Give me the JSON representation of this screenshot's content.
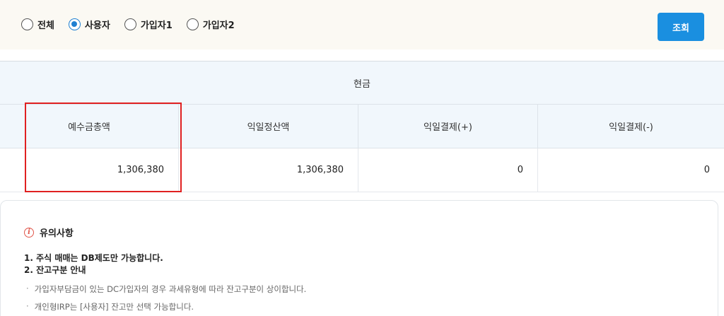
{
  "filters": {
    "options": [
      {
        "label": "전체",
        "checked": false
      },
      {
        "label": "사용자",
        "checked": true
      },
      {
        "label": "가입자1",
        "checked": false
      },
      {
        "label": "가입자2",
        "checked": false
      }
    ],
    "search_label": "조회"
  },
  "table": {
    "group_header": "현금",
    "columns": [
      "예수금총액",
      "익일정산액",
      "익일결제(+)",
      "익일결제(-)"
    ],
    "row": [
      "1,306,380",
      "1,306,380",
      "0",
      "0"
    ]
  },
  "notice": {
    "title": "유의사항",
    "icon": "info-icon",
    "lines": [
      "1. 주식 매매는 DB제도만 가능합니다.",
      "2. 잔고구분 안내"
    ],
    "bullets": [
      "가입자부담금이 있는 DC가입자의 경우 과세유형에 따라 잔고구분이 상이합니다.",
      "개인형IRP는 [사용자] 잔고만 선택 가능합니다."
    ]
  },
  "colors": {
    "accent": "#1a8fe0",
    "highlight": "#e02020",
    "header_bg": "#f1f7fc"
  }
}
